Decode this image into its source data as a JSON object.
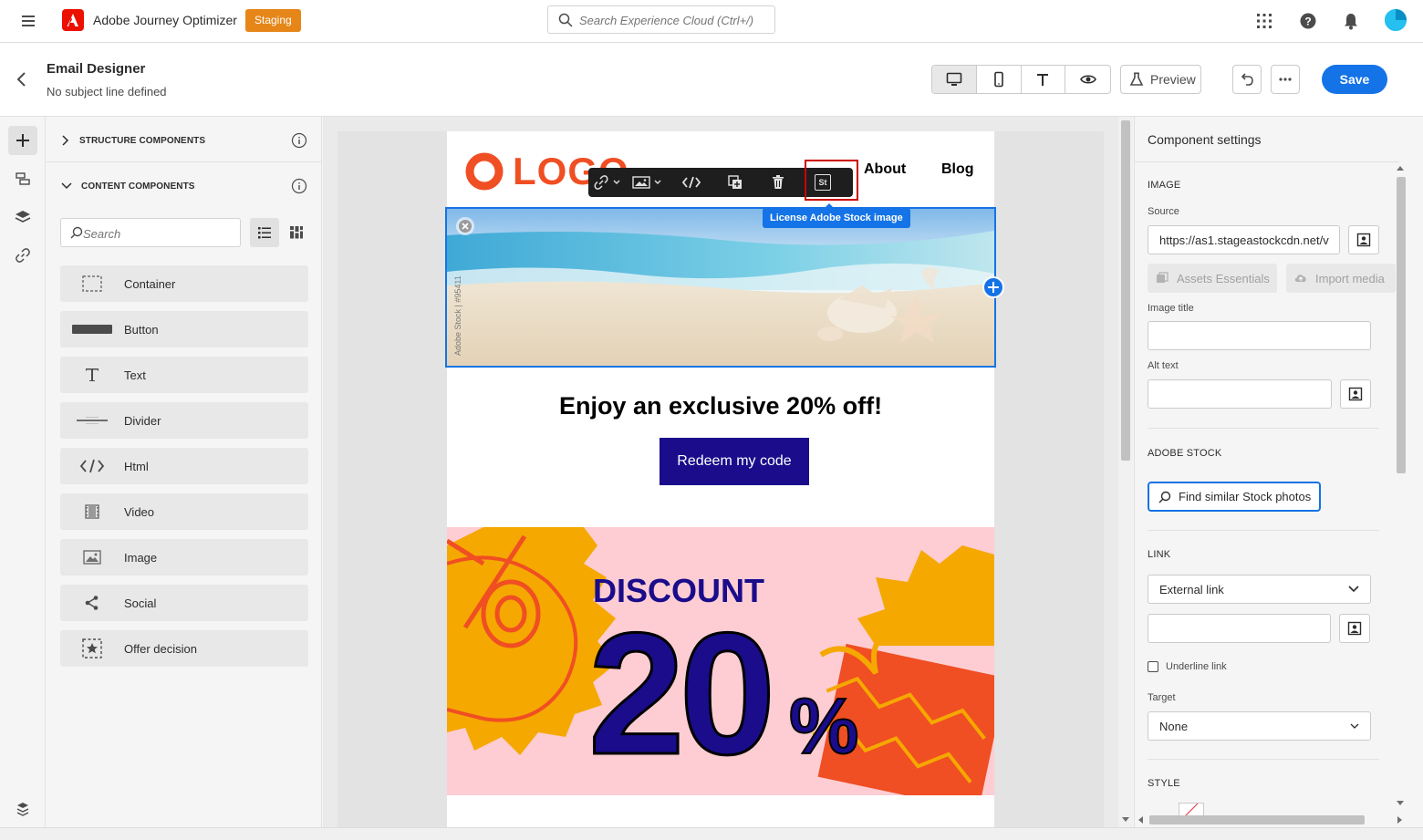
{
  "topbar": {
    "app_title": "Adobe Journey Optimizer",
    "env_badge": "Staging",
    "search_placeholder": "Search Experience Cloud (Ctrl+/)",
    "icons": [
      "hamburger-icon",
      "adobe-logo",
      "apps-grid-icon",
      "help-icon",
      "bell-icon",
      "avatar"
    ]
  },
  "header": {
    "title": "Email Designer",
    "subtitle": "No subject line defined",
    "preview_label": "Preview",
    "save_label": "Save",
    "view_modes": [
      "desktop",
      "mobile",
      "text",
      "visibility"
    ],
    "active_view": "desktop"
  },
  "components_panel": {
    "structure_title": "STRUCTURE COMPONENTS",
    "content_title": "CONTENT COMPONENTS",
    "search_placeholder": "Search",
    "items": [
      {
        "label": "Container",
        "icon": "container-icon"
      },
      {
        "label": "Button",
        "icon": "button-icon"
      },
      {
        "label": "Text",
        "icon": "text-icon"
      },
      {
        "label": "Divider",
        "icon": "divider-icon"
      },
      {
        "label": "Html",
        "icon": "html-icon"
      },
      {
        "label": "Video",
        "icon": "video-icon"
      },
      {
        "label": "Image",
        "icon": "image-icon"
      },
      {
        "label": "Social",
        "icon": "social-icon"
      },
      {
        "label": "Offer decision",
        "icon": "offer-decision-icon"
      }
    ]
  },
  "email": {
    "logo_text": "LOGO",
    "nav": [
      "About",
      "Blog"
    ],
    "tooltip": "License Adobe Stock image",
    "stock_badge": "St",
    "watermark": "Adobe Stock | #95411",
    "headline": "Enjoy an exclusive 20% off!",
    "cta_label": "Redeem my code",
    "banner_title": "DISCOUNT",
    "banner_value": "20",
    "banner_percent": "%"
  },
  "settings": {
    "title": "Component settings",
    "image_section": "IMAGE",
    "source_label": "Source",
    "source_value": "https://as1.stageastockcdn.net/v",
    "assets_essentials_label": "Assets Essentials",
    "import_media_label": "Import media",
    "image_title_label": "Image title",
    "image_title_value": "",
    "alt_text_label": "Alt text",
    "alt_text_value": "",
    "stock_section": "ADOBE STOCK",
    "find_similar_label": "Find similar Stock photos",
    "link_section": "LINK",
    "link_type": "External link",
    "link_value": "",
    "underline_label": "Underline link",
    "underline_checked": false,
    "target_label": "Target",
    "target_value": "None",
    "style_section": "STYLE"
  },
  "colors": {
    "accent": "#1473e6",
    "cta": "#1a0c8b",
    "logo": "#f04e23",
    "badge": "#e68619"
  }
}
